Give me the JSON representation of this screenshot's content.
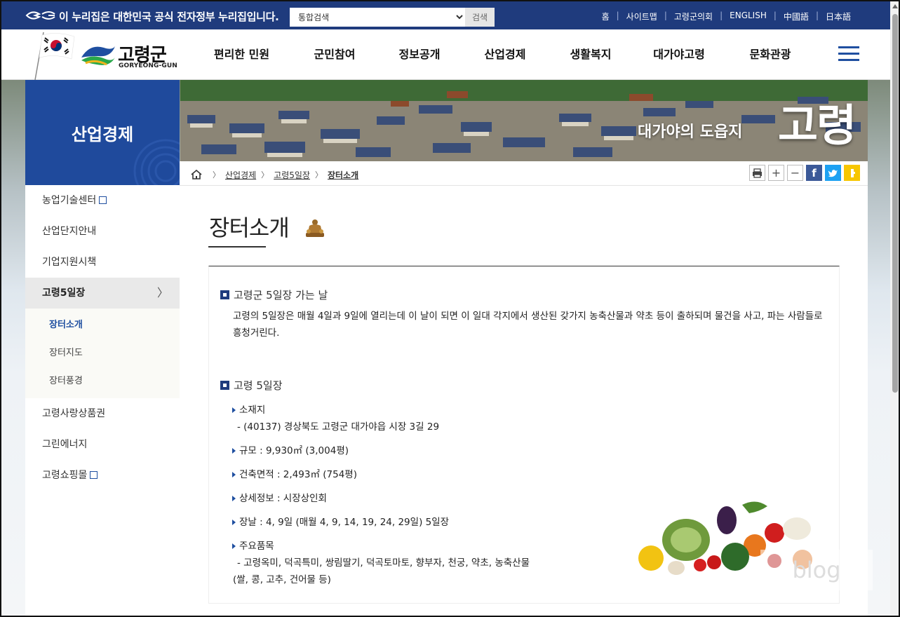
{
  "gov_bar": {
    "notice": "이 누리집은 대한민국 공식 전자정부 누리집입니다.",
    "search_select": "통합검색",
    "search_button": "검색",
    "links": [
      "홈",
      "사이트맵",
      "고령군의회",
      "ENGLISH",
      "中國語",
      "日本語"
    ]
  },
  "header": {
    "logo_name": "고령군",
    "logo_eng": "GORYEONG-GUN",
    "gnb": [
      "편리한 민원",
      "군민참여",
      "정보공개",
      "산업경제",
      "생활복지",
      "대가야고령",
      "문화관광"
    ]
  },
  "banner": {
    "slogan": "대가야의 도읍지",
    "big_text": "고령"
  },
  "sidebar": {
    "title": "산업경제",
    "items": [
      {
        "label": "농업기술센터",
        "external": true
      },
      {
        "label": "산업단지안내"
      },
      {
        "label": "기업지원시책"
      },
      {
        "label": "고령5일장",
        "active": true
      },
      {
        "label": "고령사랑상품권"
      },
      {
        "label": "그린에너지"
      },
      {
        "label": "고령쇼핑몰",
        "external": true
      }
    ],
    "sub_items": [
      {
        "label": "장터소개",
        "current": true
      },
      {
        "label": "장터지도"
      },
      {
        "label": "장터풍경"
      }
    ]
  },
  "breadcrumb": [
    "산업경제",
    "고령5일장",
    "장터소개"
  ],
  "page": {
    "title": "장터소개",
    "section1": {
      "heading": "고령군 5일장 가는 날",
      "text": "고령의 5일장은 매월 4일과 9일에 열리는데 이 날이 되면 이 일대 각지에서 생산된 갖가지 농축산물과 약초 등이 출하되며 물건을 사고, 파는 사람들로 흥청거린다."
    },
    "section2": {
      "heading": "고령 5일장",
      "location_label": "소재지",
      "location_value": "- (40137) 경상북도 고령군 대가야읍 시장 3길 29",
      "size": "규모 : 9,930㎡ (3,004평)",
      "building_area": "건축면적 : 2,493㎡ (754평)",
      "detail": "상세정보 : 시장상인회",
      "market_days": "장날 : 4, 9일 (매월 4, 9, 14, 19, 24, 29일) 5일장",
      "items_label": "주요품목",
      "items_value_1": "- 고령옥미, 덕곡특미, 쌍림딸기, 덕곡토마토, 향부자, 천궁, 약초, 농축산물",
      "items_value_2": "(쌀, 콩, 고추, 건어물 등)"
    }
  },
  "colors": {
    "gov_bar": "#1f3b7d",
    "sidebar_title": "#1f4a9c",
    "accent": "#1f4fa0"
  }
}
